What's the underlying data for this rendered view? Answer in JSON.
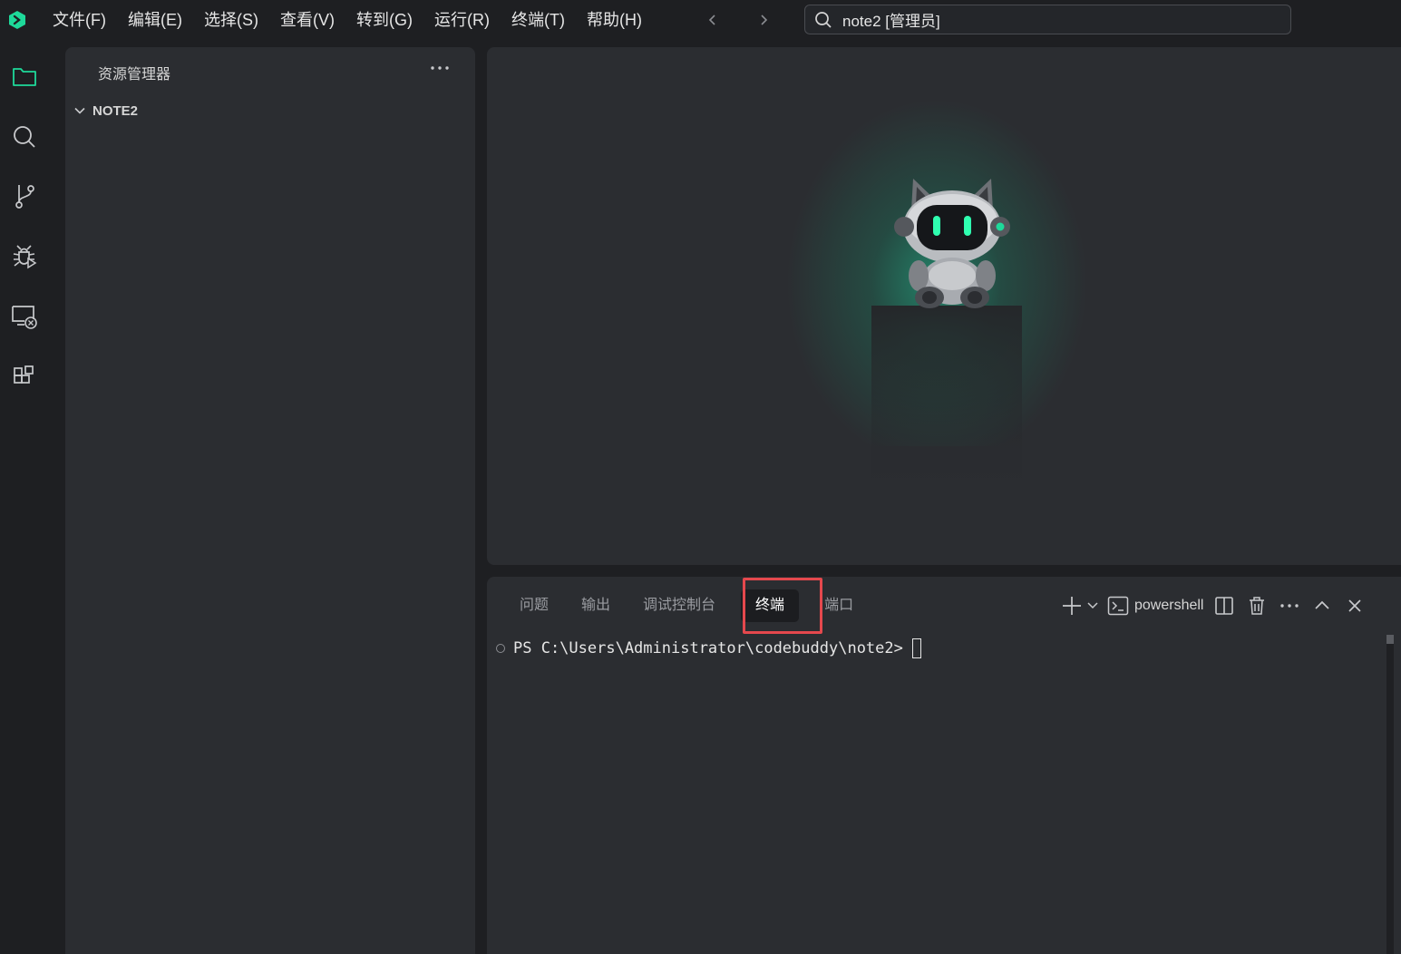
{
  "titlebar": {
    "menu": [
      "文件(F)",
      "编辑(E)",
      "选择(S)",
      "查看(V)",
      "转到(G)",
      "运行(R)",
      "终端(T)",
      "帮助(H)"
    ],
    "search_text": "note2 [管理员]",
    "accent": "#1ed99a"
  },
  "activity_bar": {
    "icons": [
      "explorer-icon",
      "search-icon",
      "source-control-icon",
      "debug-icon",
      "remote-explorer-icon",
      "extensions-icon"
    ]
  },
  "sidebar": {
    "title": "资源管理器",
    "folder": "NOTE2"
  },
  "panel": {
    "tabs": [
      "问题",
      "输出",
      "调试控制台",
      "终端",
      "端口"
    ],
    "active_tab": "终端",
    "shell_label": "powershell",
    "prompt": "PS C:\\Users\\Administrator\\codebuddy\\note2>",
    "highlight_color": "#e5484d"
  }
}
